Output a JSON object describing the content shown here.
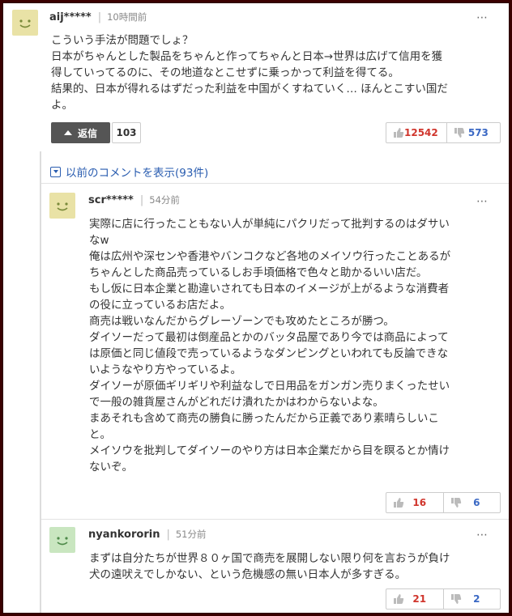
{
  "comments": [
    {
      "user": "aij*****",
      "time": "10時間前",
      "body": [
        "こういう手法が問題でしょ？",
        "日本がちゃんとした製品をちゃんと作ってちゃんと日本→世界は広げて信用を獲",
        "得していってるのに、その地道なとこせずに乗っかって利益を得てる。",
        "結果的、日本が得れるはずだった利益を中国がくすねていく… ほんとこすい国だ",
        "よ。"
      ],
      "reply_label": "返信",
      "reply_count": "103",
      "up": "12542",
      "down": "573"
    },
    {
      "user": "scr*****",
      "time": "54分前",
      "body": [
        "実際に店に行ったこともない人が単純にパクリだって批判するのはダサい",
        "なw",
        "俺は広州や深センや香港やバンコクなど各地のメイソウ行ったことあるが",
        "ちゃんとした商品売っているしお手頃価格で色々と助かるいい店だ。",
        "もし仮に日本企業と勘違いされても日本のイメージが上がるような消費者",
        "の役に立っているお店だよ。",
        "商売は戦いなんだからグレーゾーンでも攻めたところが勝つ。",
        "ダイソーだって最初は倒産品とかのバッタ品屋であり今では商品によって",
        "は原価と同じ値段で売っているようなダンピングといわれても反論できな",
        "いようなやり方やっているよ。",
        "ダイソーが原価ギリギリや利益なしで日用品をガンガン売りまくったせい",
        "で一般の雑貨屋さんがどれだけ潰れたかはわからないよな。",
        "まあそれも含めて商売の勝負に勝ったんだから正義であり素晴らしいこ",
        "と。",
        "メイソウを批判してダイソーのやり方は日本企業だから目を瞑るとか情け",
        "ないぞ。"
      ],
      "up": "16",
      "down": "6"
    },
    {
      "user": "nyankororin",
      "time": "51分前",
      "body": [
        "まずは自分たちが世界８０ヶ国で商売を展開しない限り何を言おうが負け",
        "犬の遠吠えでしかない、という危機感の無い日本人が多すぎる。"
      ],
      "up": "21",
      "down": "2"
    }
  ],
  "show_previous": "以前のコメントを表示(93件)",
  "more_icon": "⋯",
  "icons": {
    "avatar": "smiley-avatar-icon",
    "up": "thumbs-up-icon",
    "down": "thumbs-down-icon",
    "expand": "chevron-down-box-icon"
  },
  "colors": {
    "up": "#d0352c",
    "down": "#3a68c4",
    "link": "#2a5db0",
    "reply_button": "#555555",
    "avatar_yellow": "#e9e2a6",
    "avatar_green": "#c9e6c0"
  }
}
